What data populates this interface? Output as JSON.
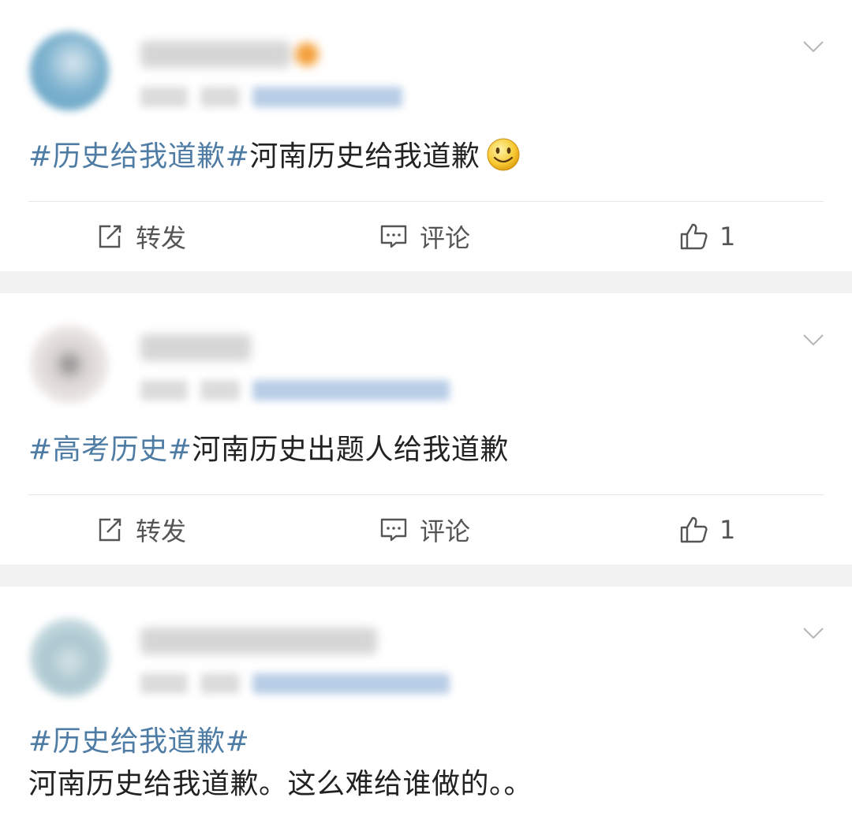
{
  "posts": [
    {
      "tag": "#历史给我道歉#",
      "body": "河南历史给我道歉",
      "emoji": "smiley-icon",
      "actions": {
        "repost": "转发",
        "comment": "评论",
        "like_count": "1"
      }
    },
    {
      "tag": "#高考历史#",
      "body": "河南历史出题人给我道歉",
      "actions": {
        "repost": "转发",
        "comment": "评论",
        "like_count": "1"
      }
    },
    {
      "tag": "#历史给我道歉#",
      "body": "河南历史给我道歉。这么难给谁做的。。"
    }
  ],
  "colors": {
    "tag": "#4e7ca4",
    "text": "#222222",
    "action_text": "#555555",
    "separator": "#f2f2f2"
  }
}
